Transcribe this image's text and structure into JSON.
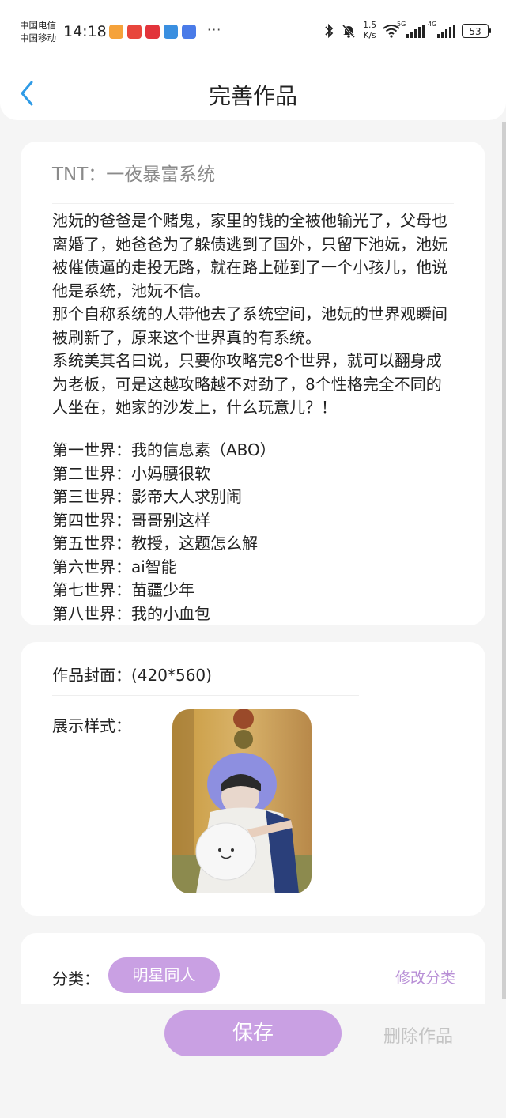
{
  "status_bar": {
    "carrier_1": "中国电信",
    "carrier_2": "中国移动",
    "time": "14:18",
    "more": "···",
    "net_speed_value": "1.5",
    "net_speed_unit": "K/s",
    "signal_1_tag": "5G",
    "signal_2_tag": "4G",
    "battery": "53"
  },
  "header": {
    "title": "完善作品"
  },
  "work": {
    "title": "TNT：一夜暴富系统",
    "synopsis": "池妧的爸爸是个赌鬼，家里的钱的全被他输光了，父母也离婚了，她爸爸为了躲债逃到了国外，只留下池妧，池妧被催债逼的走投无路，就在路上碰到了一个小孩儿，他说他是系统，池妧不信。\n那个自称系统的人带他去了系统空间，池妧的世界观瞬间被刷新了，原来这个世界真的有系统。\n系统美其名曰说，只要你攻略完8个世界，就可以翻身成为老板，可是这越攻略越不对劲了，8个性格完全不同的人坐在，她家的沙发上，什么玩意儿？！",
    "worlds": [
      "第一世界：我的信息素（ABO）",
      "第二世界：小妈腰很软",
      "第三世界：影帝大人求别闹",
      "第四世界：哥哥别这样",
      "第五世界：教授，这题怎么解",
      "第六世界：ai智能",
      "第七世界：苗疆少年",
      "第八世界：我的小血包"
    ]
  },
  "cover": {
    "label": "作品封面：(420*560)",
    "style_label": "展示样式："
  },
  "category": {
    "label": "分类：",
    "value": "明星同人",
    "edit": "修改分类"
  },
  "actions": {
    "save": "保存",
    "delete": "删除作品"
  },
  "colors": {
    "accent": "#c9a0e3",
    "accent_text": "#b88fd6",
    "back_arrow": "#2f9be6"
  }
}
